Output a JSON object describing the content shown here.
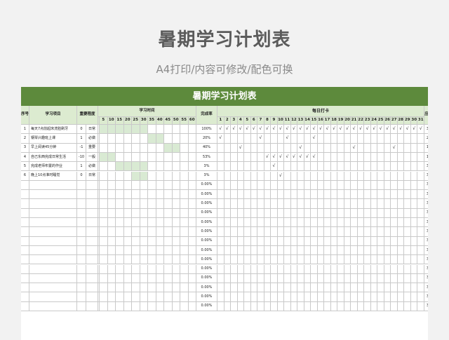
{
  "page": {
    "title": "暑期学习计划表",
    "subtitle": "A4打印/内容可修改/配色可换"
  },
  "sheet": {
    "title": "暑期学习计划表",
    "headers": {
      "seq": "序号",
      "item": "学习项目",
      "importance": "重要程度",
      "study_time": "学习时间",
      "completion_rate": "完成率",
      "daily_checkin": "每日打卡",
      "should_complete": "应完成",
      "completed": "完成"
    },
    "time_scale": [
      "5",
      "10",
      "15",
      "20",
      "25",
      "30",
      "35",
      "40",
      "45",
      "50",
      "55",
      "60"
    ],
    "days": [
      "1",
      "2",
      "3",
      "4",
      "5",
      "6",
      "7",
      "8",
      "9",
      "10",
      "11",
      "12",
      "13",
      "14",
      "15",
      "16",
      "17",
      "18",
      "19",
      "20",
      "21",
      "22",
      "23",
      "24",
      "25",
      "26",
      "27",
      "28",
      "29",
      "30",
      "31"
    ],
    "check_mark": "√",
    "rows": [
      {
        "seq": "1",
        "item": "每天7点前起床洗脸刷牙",
        "priority_num": "0",
        "priority": "日常",
        "time_from": 0,
        "time_to": 6,
        "rate": "100%",
        "checks": [
          1,
          2,
          3,
          4,
          5,
          6,
          7,
          8,
          9,
          10,
          11,
          12,
          13,
          14,
          15,
          16,
          17,
          18,
          19,
          20,
          21,
          22,
          23,
          24,
          25,
          26,
          27,
          28,
          29,
          30,
          31
        ],
        "should": "31天",
        "done": "31"
      },
      {
        "seq": "2",
        "item": "钢琴兴趣班上课",
        "priority_num": "1",
        "priority": "必做",
        "time_from": 6,
        "time_to": 8,
        "rate": "20%",
        "checks": [
          1,
          7,
          11,
          15
        ],
        "should": "20天",
        "done": "4"
      },
      {
        "seq": "3",
        "item": "早上阅读45分钟",
        "priority_num": "-1",
        "priority": "重要",
        "time_from": 8,
        "time_to": 10,
        "rate": "40%",
        "checks": [
          4,
          13,
          21,
          27
        ],
        "should": "10天",
        "done": "4"
      },
      {
        "seq": "4",
        "item": "自己东西完成日常生活",
        "priority_num": "-10",
        "priority": "一般",
        "time_from": 0,
        "time_to": 2,
        "rate": "53%",
        "checks": [
          8,
          9,
          10,
          11,
          12,
          13,
          14,
          15
        ],
        "should": "15天",
        "done": "8"
      },
      {
        "seq": "5",
        "item": "完成老师布置的作业",
        "priority_num": "1",
        "priority": "必做",
        "time_from": 2,
        "time_to": 6,
        "rate": "3%",
        "checks": [
          9
        ],
        "should": "31天",
        "done": "1"
      },
      {
        "seq": "6",
        "item": "晚上10点准时睡觉",
        "priority_num": "0",
        "priority": "日常",
        "time_from": 4,
        "time_to": 6,
        "rate": "3%",
        "checks": [
          10
        ],
        "should": "31天",
        "done": "1"
      },
      {
        "seq": "",
        "item": "",
        "priority_num": "",
        "priority": "",
        "rate": "0.00%",
        "checks": [],
        "should": "31天",
        "done": "0"
      },
      {
        "seq": "",
        "item": "",
        "priority_num": "",
        "priority": "",
        "rate": "0.00%",
        "checks": [],
        "should": "31天",
        "done": "0"
      },
      {
        "seq": "",
        "item": "",
        "priority_num": "",
        "priority": "",
        "rate": "0.00%",
        "checks": [],
        "should": "31天",
        "done": "0"
      },
      {
        "seq": "",
        "item": "",
        "priority_num": "",
        "priority": "",
        "rate": "0.00%",
        "checks": [],
        "should": "31天",
        "done": "0"
      },
      {
        "seq": "",
        "item": "",
        "priority_num": "",
        "priority": "",
        "rate": "0.00%",
        "checks": [],
        "should": "31天",
        "done": "0"
      },
      {
        "seq": "",
        "item": "",
        "priority_num": "",
        "priority": "",
        "rate": "0.00%",
        "checks": [],
        "should": "31天",
        "done": "0"
      },
      {
        "seq": "",
        "item": "",
        "priority_num": "",
        "priority": "",
        "rate": "0.00%",
        "checks": [],
        "should": "31天",
        "done": "0"
      },
      {
        "seq": "",
        "item": "",
        "priority_num": "",
        "priority": "",
        "rate": "0.00%",
        "checks": [],
        "should": "31天",
        "done": "0"
      },
      {
        "seq": "",
        "item": "",
        "priority_num": "",
        "priority": "",
        "rate": "0.00%",
        "checks": [],
        "should": "31天",
        "done": "0"
      },
      {
        "seq": "",
        "item": "",
        "priority_num": "",
        "priority": "",
        "rate": "0.00%",
        "checks": [],
        "should": "31天",
        "done": "0"
      },
      {
        "seq": "",
        "item": "",
        "priority_num": "",
        "priority": "",
        "rate": "0.00%",
        "checks": [],
        "should": "31天",
        "done": "0"
      },
      {
        "seq": "",
        "item": "",
        "priority_num": "",
        "priority": "",
        "rate": "0.00%",
        "checks": [],
        "should": "31天",
        "done": "0"
      },
      {
        "seq": "",
        "item": "",
        "priority_num": "",
        "priority": "",
        "rate": "0.00%",
        "checks": [],
        "should": "31天",
        "done": "0"
      },
      {
        "seq": "",
        "item": "",
        "priority_num": "",
        "priority": "",
        "rate": "0.00%",
        "checks": [],
        "should": "31天",
        "done": "0"
      }
    ]
  }
}
